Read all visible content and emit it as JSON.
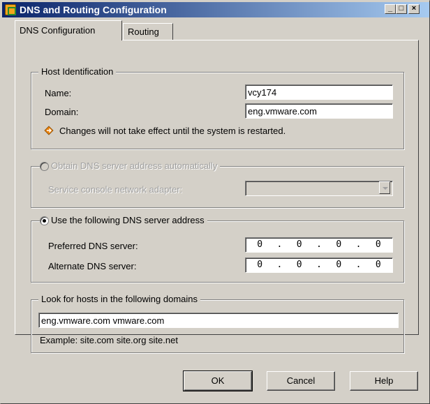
{
  "window": {
    "title": "DNS and Routing Configuration",
    "controls": {
      "minimize": "_",
      "maximize": "□",
      "close": "×"
    }
  },
  "tabs": [
    {
      "label": "DNS Configuration",
      "active": true
    },
    {
      "label": "Routing",
      "active": false
    }
  ],
  "host_identification": {
    "legend": "Host Identification",
    "name_label": "Name:",
    "name_value": "vcy174",
    "domain_label": "Domain:",
    "domain_value": "eng.vmware.com",
    "warning_icon": "warning-arrow-icon",
    "warning_text": "Changes will not take effect until the system is restarted."
  },
  "obtain_dns": {
    "legend": "Obtain DNS server address automatically",
    "selected": false,
    "disabled": true,
    "adapter_label": "Service console network adapter:",
    "adapter_value": ""
  },
  "use_dns": {
    "legend": "Use the following DNS server address",
    "selected": true,
    "preferred_label": "Preferred DNS server:",
    "preferred_octets": [
      "0",
      "0",
      "0",
      "0"
    ],
    "alternate_label": "Alternate DNS server:",
    "alternate_octets": [
      "0",
      "0",
      "0",
      "0"
    ]
  },
  "search_domains": {
    "legend": "Look for hosts in the following domains",
    "value": "eng.vmware.com vmware.com",
    "example": "Example: site.com site.org site.net"
  },
  "buttons": {
    "ok": "OK",
    "cancel": "Cancel",
    "help": "Help"
  },
  "colors": {
    "dialog_bg": "#d4d0c8",
    "title_start": "#0a246a",
    "title_end": "#a6caf0",
    "warning_icon": "#e8820c"
  }
}
